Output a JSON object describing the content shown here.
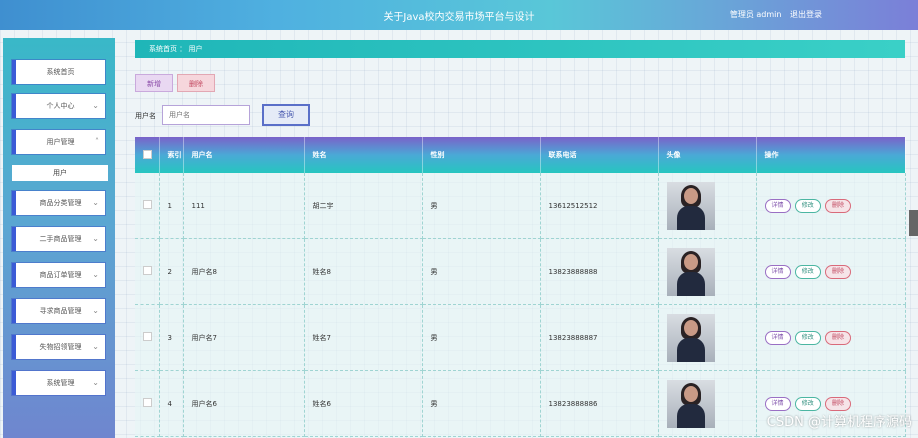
{
  "header": {
    "title": "关于Java校内交易市场平台与设计",
    "user_text": "管理员 admin",
    "logout": "退出登录"
  },
  "sidebar": {
    "items": [
      {
        "label": "系统首页"
      },
      {
        "label": "个人中心"
      },
      {
        "label": "用户管理"
      },
      {
        "label": "用户"
      },
      {
        "label": "商品分类管理"
      },
      {
        "label": "二手商品管理"
      },
      {
        "label": "商品订单管理"
      },
      {
        "label": "寻求商品管理"
      },
      {
        "label": "失物招领管理"
      },
      {
        "label": "系统管理"
      }
    ]
  },
  "breadcrumb": {
    "home": "系统首页",
    "sep": "：",
    "current": "用户"
  },
  "toolbar": {
    "add_label": "新增",
    "delete_label": "删除",
    "search_label": "查询"
  },
  "search": {
    "field_label": "用户名",
    "placeholder": "用户名"
  },
  "table": {
    "headers": [
      "索引",
      "用户名",
      "姓名",
      "性别",
      "联系电话",
      "头像",
      "操作"
    ],
    "rows": [
      {
        "index": "1",
        "username": "111",
        "name": "胡二宇",
        "gender": "男",
        "phone": "13612512512"
      },
      {
        "index": "2",
        "username": "用户名8",
        "name": "姓名8",
        "gender": "男",
        "phone": "13823888888"
      },
      {
        "index": "3",
        "username": "用户名7",
        "name": "姓名7",
        "gender": "男",
        "phone": "13823888887"
      },
      {
        "index": "4",
        "username": "用户名6",
        "name": "姓名6",
        "gender": "男",
        "phone": "13823888886"
      }
    ],
    "actions": {
      "detail": "详情",
      "edit": "修改",
      "delete": "删除"
    }
  },
  "watermark": "CSDN @计算机程序源码"
}
